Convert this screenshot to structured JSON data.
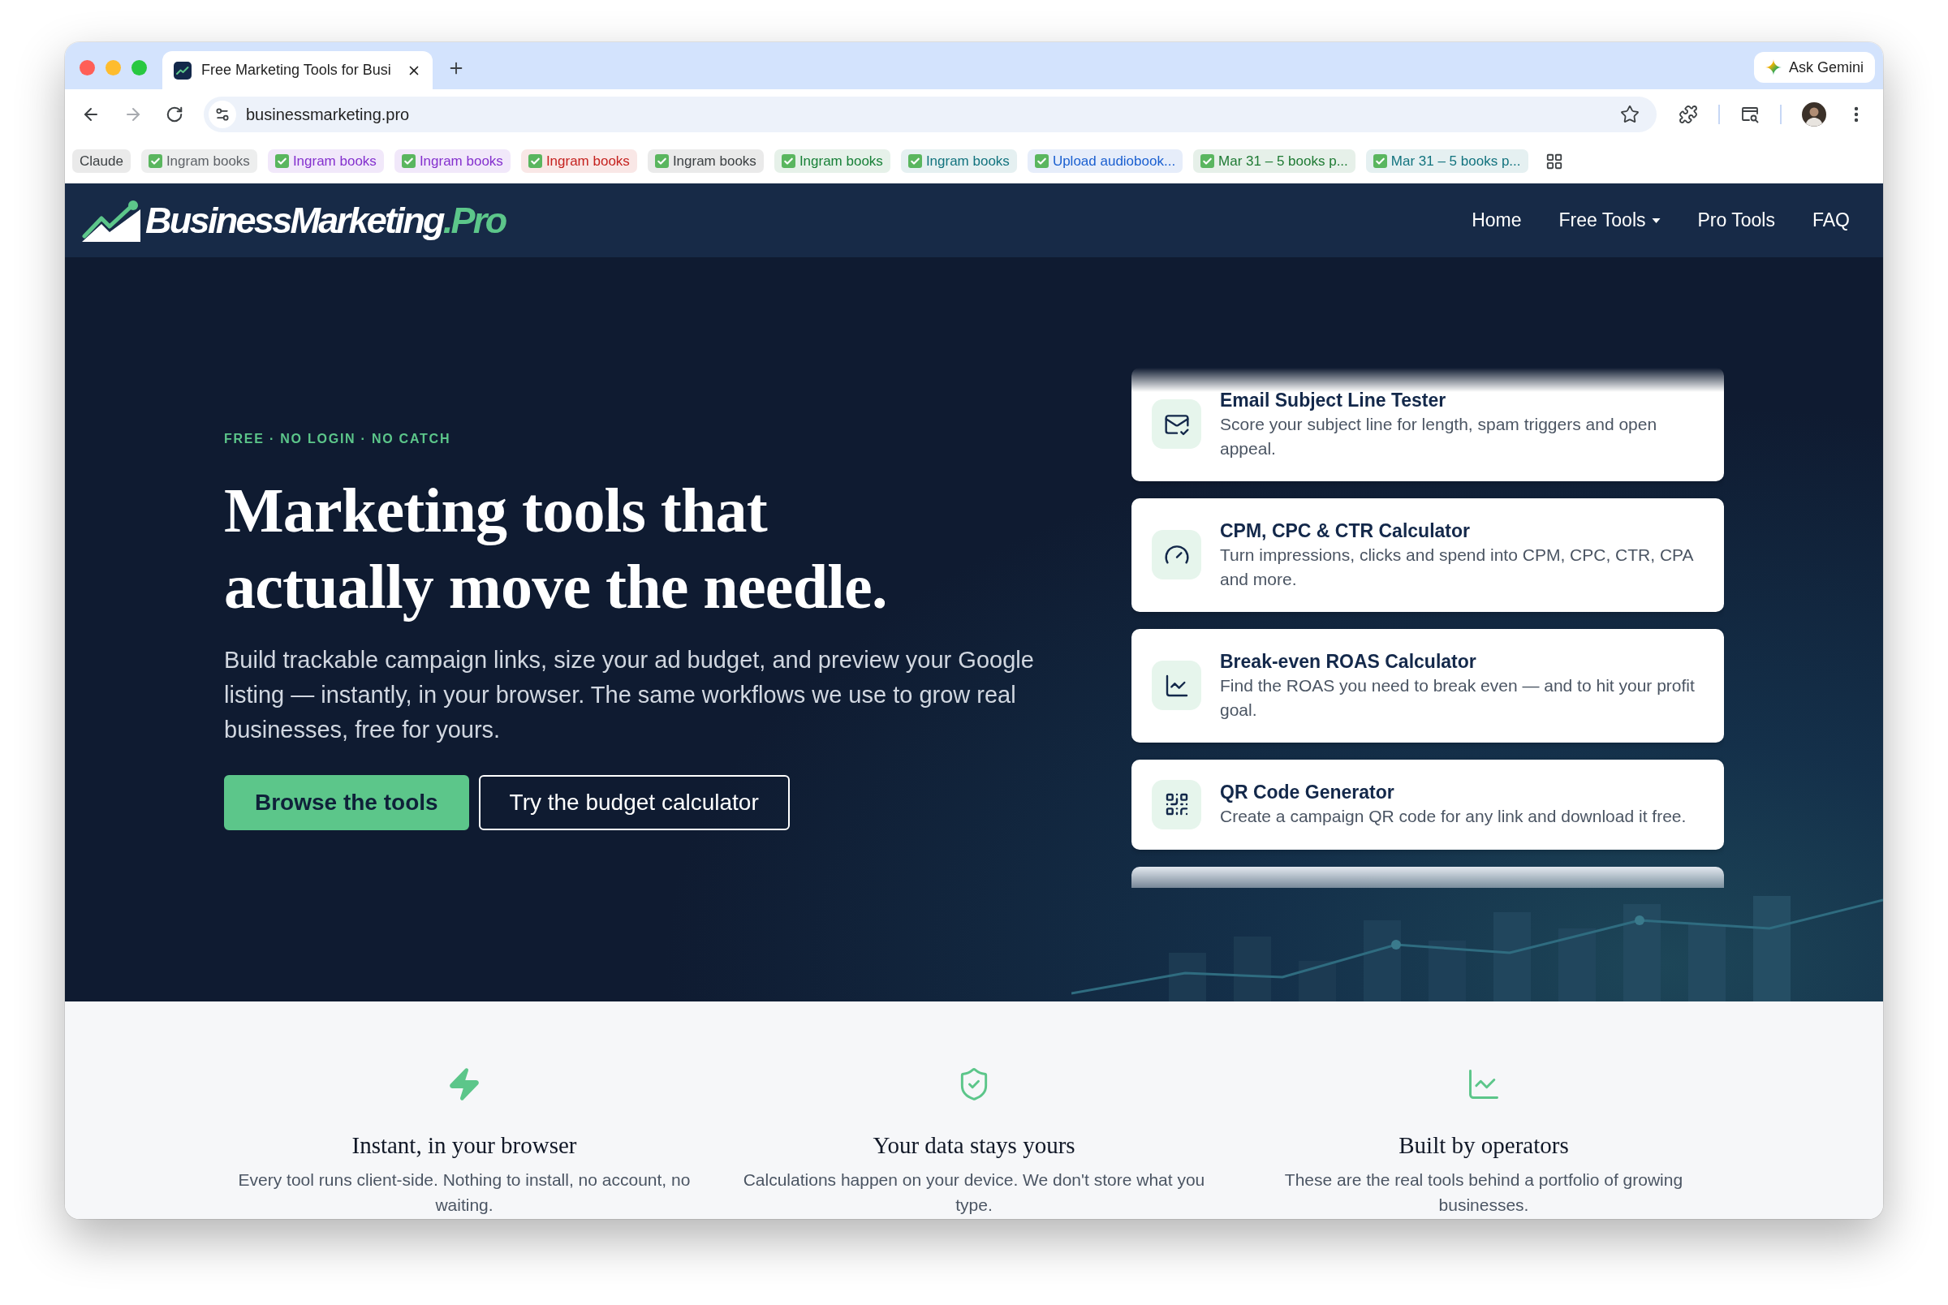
{
  "browser": {
    "tabs": [
      {
        "title": "Free Marketing Tools for Busi",
        "selected": true
      }
    ],
    "assistant_button": "Ask Gemini",
    "forward_disabled": true,
    "address": "businessmarketing.pro",
    "bookmarks": [
      {
        "label": "Claude",
        "checked": false,
        "color": "#3c4043"
      },
      {
        "label": "Ingram books",
        "checked": true,
        "color": "#5f6368"
      },
      {
        "label": "Ingram books",
        "checked": true,
        "color": "#8430ce"
      },
      {
        "label": "Ingram books",
        "checked": true,
        "color": "#8430ce"
      },
      {
        "label": "Ingram books",
        "checked": true,
        "color": "#c5221f"
      },
      {
        "label": "Ingram books",
        "checked": true,
        "color": "#3c4043"
      },
      {
        "label": "Ingram books",
        "checked": true,
        "color": "#188038"
      },
      {
        "label": "Ingram books",
        "checked": true,
        "color": "#12737e"
      },
      {
        "label": "Upload audiobook...",
        "checked": true,
        "color": "#1a5fd0"
      },
      {
        "label": "Mar 31 – 5 books p...",
        "checked": true,
        "color": "#1e7a33"
      },
      {
        "label": "Mar 31 – 5 books p...",
        "checked": true,
        "color": "#12737e"
      }
    ]
  },
  "site": {
    "logo": {
      "name": "BusinessMarketing",
      "suffix": ".Pro"
    },
    "nav": [
      {
        "label": "Home",
        "dropdown": false
      },
      {
        "label": "Free Tools",
        "dropdown": true
      },
      {
        "label": "Pro Tools",
        "dropdown": false
      },
      {
        "label": "FAQ",
        "dropdown": false
      }
    ]
  },
  "hero": {
    "eyebrow": "FREE · NO LOGIN · NO CATCH",
    "headline": "Marketing tools that actually move the needle.",
    "intro": "Build trackable campaign links, size your ad budget, and preview your Google listing — instantly, in your browser. The same workflows we use to grow real businesses, free for yours.",
    "buttons": [
      {
        "label": "Browse the tools",
        "kind": "primary"
      },
      {
        "label": "Try the budget calculator",
        "kind": "outline"
      }
    ]
  },
  "tools": [
    {
      "title": "Email Subject Line Tester",
      "description": "Score your subject line for length, spam triggers and open appeal."
    },
    {
      "title": "CPM, CPC & CTR Calculator",
      "description": "Turn impressions, clicks and spend into CPM, CPC, CTR, CPA and more."
    },
    {
      "title": "Break-even ROAS Calculator",
      "description": "Find the ROAS you need to break even — and to hit your profit goal."
    },
    {
      "title": "QR Code Generator",
      "description": "Create a campaign QR code for any link and download it free."
    }
  ],
  "features": [
    {
      "title": "Instant, in your browser",
      "description": "Every tool runs client-side. Nothing to install, no account, no waiting."
    },
    {
      "title": "Your data stays yours",
      "description": "Calculations happen on your device. We don't store what you type."
    },
    {
      "title": "Built by operators",
      "description": "These are the real tools behind a portfolio of growing businesses."
    }
  ]
}
